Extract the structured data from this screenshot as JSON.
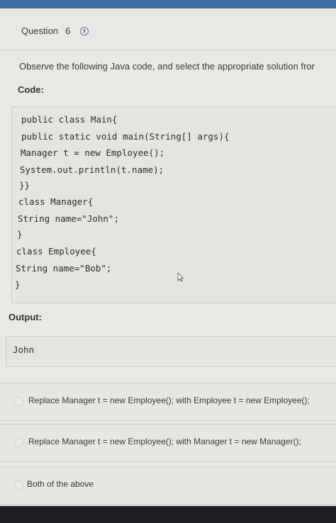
{
  "question": {
    "label": "Question",
    "number": "6",
    "instruction": "Observe the following Java code, and select the appropriate solution fror",
    "code_label": "Code:",
    "code_lines": [
      "public class Main{",
      "public static void main(String[] args){",
      "Manager t = new Employee();",
      "System.out.println(t.name);",
      "}}",
      "class Manager{",
      "String name=\"John\";",
      "}",
      "class Employee{",
      "String name=\"Bob\";",
      "}"
    ],
    "output_label": "Output:",
    "output_value": "John"
  },
  "options": [
    {
      "label": "Replace Manager t = new Employee(); with Employee t = new Employee();",
      "selected": false
    },
    {
      "label": "Replace Manager t = new Employee(); with Manager t = new Manager();",
      "selected": false
    },
    {
      "label": "Both of the above",
      "selected": false
    }
  ],
  "icons": {
    "info": "info-icon",
    "cursor": "mouse-cursor-icon"
  },
  "colors": {
    "accent": "#4d7cb7",
    "top_bar": "#3f6fa2"
  }
}
